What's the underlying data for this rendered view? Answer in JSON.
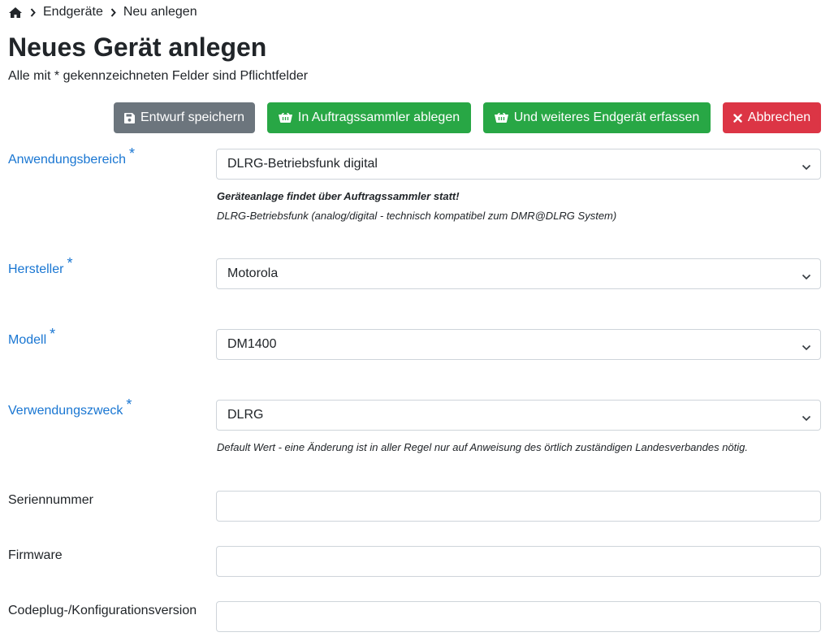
{
  "breadcrumb": {
    "home_icon": "home-icon",
    "separator_icon": "chevron-right-icon",
    "items": [
      "Endgeräte",
      "Neu anlegen"
    ]
  },
  "page": {
    "title": "Neues Gerät anlegen",
    "subtitle": "Alle mit * gekennzeichneten Felder sind Pflichtfelder"
  },
  "actions": {
    "save_draft": {
      "label": "Entwurf speichern",
      "icon": "floppy-disk-icon",
      "color": "#6c757d"
    },
    "to_collector": {
      "label": "In Auftragssammler ablegen",
      "icon": "basket-icon",
      "color": "#28a745"
    },
    "add_another": {
      "label": "Und weiteres Endgerät erfassen",
      "icon": "basket-icon",
      "color": "#28a745"
    },
    "cancel": {
      "label": "Abbrechen",
      "icon": "close-icon",
      "color": "#dc3545"
    }
  },
  "form": {
    "required_marker": "*",
    "anwendungsbereich": {
      "label": "Anwendungsbereich",
      "value": "DLRG-Betriebsfunk digital",
      "help_bold": "Geräteanlage findet über Auftragssammler statt!",
      "help": "DLRG-Betriebsfunk (analog/digital - technisch kompatibel zum DMR@DLRG System)"
    },
    "hersteller": {
      "label": "Hersteller",
      "value": "Motorola"
    },
    "modell": {
      "label": "Modell",
      "value": "DM1400"
    },
    "verwendungszweck": {
      "label": "Verwendungszweck",
      "value": "DLRG",
      "help": "Default Wert - eine Änderung ist in aller Regel nur auf Anweisung des örtlich zuständigen Landesverbandes nötig."
    },
    "seriennummer": {
      "label": "Seriennummer",
      "value": ""
    },
    "firmware": {
      "label": "Firmware",
      "value": ""
    },
    "codeplug": {
      "label": "Codeplug-/Konfigurationsversion",
      "value": ""
    }
  },
  "colors": {
    "required_label": "#1976d2",
    "text": "#212529",
    "border": "#ced4da"
  }
}
